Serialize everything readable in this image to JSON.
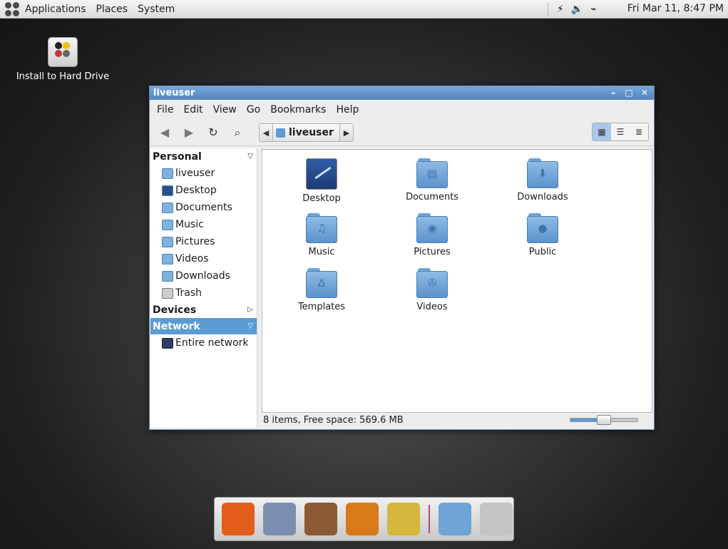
{
  "top_panel": {
    "menus": [
      "Applications",
      "Places",
      "System"
    ],
    "clock": "Fri Mar 11,  8:47 PM",
    "tray_icons": [
      "power-icon",
      "volume-icon",
      "network-icon"
    ]
  },
  "desktop": {
    "icons": [
      {
        "label": "Install to Hard Drive",
        "icon": "hard-drive-install-icon"
      }
    ]
  },
  "window": {
    "title": "liveuser",
    "controls": [
      "minimize",
      "maximize",
      "close"
    ],
    "menubar": [
      "File",
      "Edit",
      "View",
      "Go",
      "Bookmarks",
      "Help"
    ],
    "toolbar": {
      "buttons": [
        "back-icon",
        "forward-icon",
        "reload-icon",
        "search-icon"
      ],
      "path": "liveuser",
      "view_modes": [
        "icon-view",
        "list-view",
        "compact-view"
      ],
      "active_view": "icon-view"
    },
    "sidebar": {
      "personal": {
        "title": "Personal",
        "items": [
          "liveuser",
          "Desktop",
          "Documents",
          "Music",
          "Pictures",
          "Videos",
          "Downloads",
          "Trash"
        ]
      },
      "devices": {
        "title": "Devices"
      },
      "network": {
        "title": "Network",
        "items": [
          "Entire network"
        ]
      }
    },
    "files": [
      {
        "name": "Desktop",
        "glyph": ""
      },
      {
        "name": "Documents",
        "glyph": "▤"
      },
      {
        "name": "Downloads",
        "glyph": "⬇"
      },
      {
        "name": "Music",
        "glyph": "♫"
      },
      {
        "name": "Pictures",
        "glyph": "◉"
      },
      {
        "name": "Public",
        "glyph": "●"
      },
      {
        "name": "Templates",
        "glyph": "∆"
      },
      {
        "name": "Videos",
        "glyph": "✇"
      }
    ],
    "status": "8 items, Free space: 569.6 MB",
    "zoom_level": 0.5
  },
  "dock": {
    "apps": [
      "firefox-icon",
      "mail-client-icon",
      "audio-player-icon",
      "vlc-icon",
      "thunar-icon",
      "folder-icon",
      "trash-icon"
    ],
    "colors": [
      "#e25d1a",
      "#7a8fb0",
      "#8c5a32",
      "#d97a1a",
      "#d6b63c",
      "#6fa4d6",
      "#c4c4c4"
    ]
  }
}
